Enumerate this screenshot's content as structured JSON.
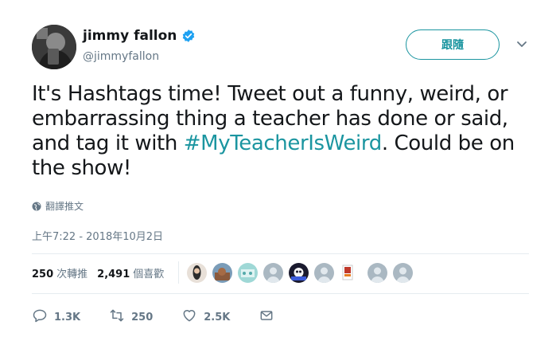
{
  "user": {
    "display_name": "jimmy fallon",
    "handle": "@jimmyfallon",
    "verified_icon": "verified-badge-icon"
  },
  "follow_label": "跟隨",
  "tweet": {
    "text_before": "It's Hashtags time! Tweet out a funny, weird, or embarrassing thing a teacher has done or said, and tag it with ",
    "hashtag": "#MyTeacherIsWeird",
    "text_after": ". Could be on the show!"
  },
  "translate_label": "翻譯推文",
  "timestamp": "上午7:22 - 2018年10月2日",
  "stats": {
    "retweets_count": "250",
    "retweets_label": "次轉推",
    "likes_count": "2,491",
    "likes_label": "個喜歡"
  },
  "actions": {
    "reply_count": "1.3K",
    "retweet_count": "250",
    "like_count": "2.5K"
  },
  "colors": {
    "accent": "#1b95a0",
    "verified": "#1da1f2",
    "muted": "#657786"
  }
}
